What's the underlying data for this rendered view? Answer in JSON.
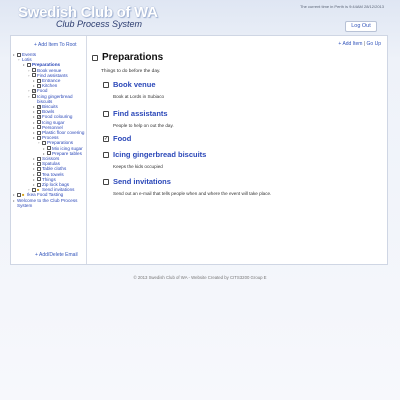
{
  "header": {
    "title": "Swedish Club of WA",
    "subtitle": "Club Process System",
    "time_info": "The current time in Perth is 9:44AM 28/12/2013",
    "logout_label": "Log Out"
  },
  "sidebar": {
    "add_root_label": "+ Add Item To Root",
    "tree": [
      {
        "depth": 0,
        "checkbox": "empty",
        "label": "Events"
      },
      {
        "depth": 1,
        "checkbox": "none",
        "label": "Lotis"
      },
      {
        "depth": 2,
        "checkbox": "empty",
        "label": "Preparations",
        "bold": true
      },
      {
        "depth": 3,
        "checkbox": "empty",
        "label": "Book venue"
      },
      {
        "depth": 3,
        "checkbox": "empty",
        "label": "Find assistants"
      },
      {
        "depth": 4,
        "checkbox": "empty",
        "label": "Entrance"
      },
      {
        "depth": 4,
        "checkbox": "empty",
        "label": "Kitchen"
      },
      {
        "depth": 3,
        "checkbox": "checked",
        "label": "Food"
      },
      {
        "depth": 3,
        "checkbox": "empty",
        "label": "Icing gingerbread biscuits"
      },
      {
        "depth": 4,
        "checkbox": "checked",
        "label": "Biscuits"
      },
      {
        "depth": 4,
        "checkbox": "empty",
        "label": "Bowls"
      },
      {
        "depth": 4,
        "checkbox": "checked",
        "label": "Food colouring"
      },
      {
        "depth": 4,
        "checkbox": "empty",
        "label": "Icing sugar"
      },
      {
        "depth": 4,
        "checkbox": "empty",
        "label": "Personnel"
      },
      {
        "depth": 4,
        "checkbox": "empty",
        "label": "Plastic floor covering"
      },
      {
        "depth": 4,
        "checkbox": "empty",
        "label": "Process"
      },
      {
        "depth": 5,
        "checkbox": "empty",
        "label": "Preparations"
      },
      {
        "depth": 6,
        "checkbox": "empty",
        "label": "Mix icing sugar"
      },
      {
        "depth": 6,
        "checkbox": "empty",
        "label": "Prepare tables"
      },
      {
        "depth": 4,
        "checkbox": "empty",
        "label": "Scissors"
      },
      {
        "depth": 4,
        "checkbox": "empty",
        "label": "Spatulas"
      },
      {
        "depth": 4,
        "checkbox": "empty",
        "label": "Table cloths"
      },
      {
        "depth": 4,
        "checkbox": "empty",
        "label": "Tea towels"
      },
      {
        "depth": 4,
        "checkbox": "empty",
        "label": "Things"
      },
      {
        "depth": 4,
        "checkbox": "empty",
        "label": "Zip lock bags"
      },
      {
        "depth": 3,
        "checkbox": "empty",
        "lock": true,
        "label": "Send invitations"
      },
      {
        "depth": 0,
        "checkbox": "empty",
        "lock": true,
        "label": "Ikea Food Tasting"
      },
      {
        "depth": 0,
        "checkbox": "none",
        "label": "Welcome to the Club Process System"
      }
    ],
    "add_delete_email_label": "+ Add/Delete Email"
  },
  "main": {
    "add_item_label": "+ Add Item",
    "separator": "|",
    "go_up_label": "Go Up",
    "page_title": "Preparations",
    "page_description": "Things to do before the day.",
    "items": [
      {
        "title": "Book venue",
        "description": "Book at Lords in Subiaco",
        "checked": false
      },
      {
        "title": "Find assistants",
        "description": "People to help on out the day.",
        "checked": false
      },
      {
        "title": "Food",
        "description": "",
        "checked": true
      },
      {
        "title": "Icing gingerbread biscuits",
        "description": "Keeps the kids occupied",
        "checked": false
      },
      {
        "title": "Send invitations",
        "description": "Send out an e-mail that tells people when and where the event will take place.",
        "checked": false
      }
    ]
  },
  "footer": {
    "text": "© 2013 Swedish Club of WA - Website Created by CITS3200 Group E"
  },
  "colors": {
    "link": "#2a47b8",
    "title_text": "#ffffff",
    "subtitle_text": "#2a3b6e",
    "background_top": "#dfe6f3"
  },
  "icons": {
    "checkbox": "square-checkbox",
    "lock": "lock-icon",
    "bullet": "bullet-icon"
  }
}
